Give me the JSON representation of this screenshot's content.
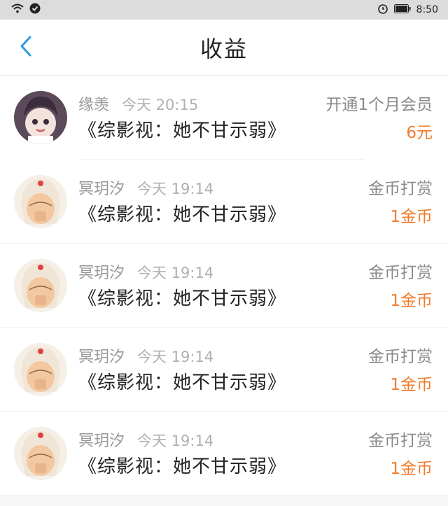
{
  "status_bar": {
    "time": "8:50"
  },
  "header": {
    "title": "收益"
  },
  "rows": [
    {
      "user": "缘羡",
      "time": "今天 20:15",
      "book": "《综影视：她不甘示弱》",
      "action": "开通1个月会员",
      "amount": "6元"
    },
    {
      "user": "冥玥汐",
      "time": "今天 19:14",
      "book": "《综影视：她不甘示弱》",
      "action": "金币打赏",
      "amount": "1金币"
    },
    {
      "user": "冥玥汐",
      "time": "今天 19:14",
      "book": "《综影视：她不甘示弱》",
      "action": "金币打赏",
      "amount": "1金币"
    },
    {
      "user": "冥玥汐",
      "time": "今天 19:14",
      "book": "《综影视：她不甘示弱》",
      "action": "金币打赏",
      "amount": "1金币"
    },
    {
      "user": "冥玥汐",
      "time": "今天 19:14",
      "book": "《综影视：她不甘示弱》",
      "action": "金币打赏",
      "amount": "1金币"
    }
  ],
  "colors": {
    "accent_blue": "#2f9be6",
    "amount_orange": "#f07b2a"
  },
  "icons": {
    "back": "chevron-left-icon",
    "wifi": "wifi-icon",
    "battery": "battery-icon",
    "alarm": "alarm-icon"
  }
}
